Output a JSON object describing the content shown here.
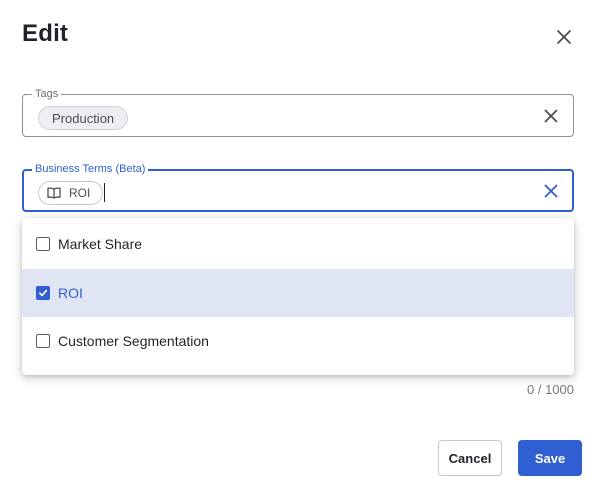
{
  "dialog": {
    "title": "Edit"
  },
  "tags": {
    "legend": "Tags",
    "chips": [
      "Production"
    ]
  },
  "business_terms": {
    "legend": "Business Terms (Beta)",
    "chips": [
      "ROI"
    ]
  },
  "dropdown": {
    "options": [
      {
        "label": "Market Share",
        "checked": false
      },
      {
        "label": "ROI",
        "checked": true
      },
      {
        "label": "Customer Segmentation",
        "checked": false
      }
    ]
  },
  "counter": "0 / 1000",
  "actions": {
    "cancel_label": "Cancel",
    "save_label": "Save"
  },
  "colors": {
    "accent": "#2f5fd0",
    "selected_row": "#dfe5f3"
  },
  "icons": {
    "close": "close-icon",
    "clear": "clear-icon",
    "term": "book-icon",
    "check": "check-icon"
  }
}
